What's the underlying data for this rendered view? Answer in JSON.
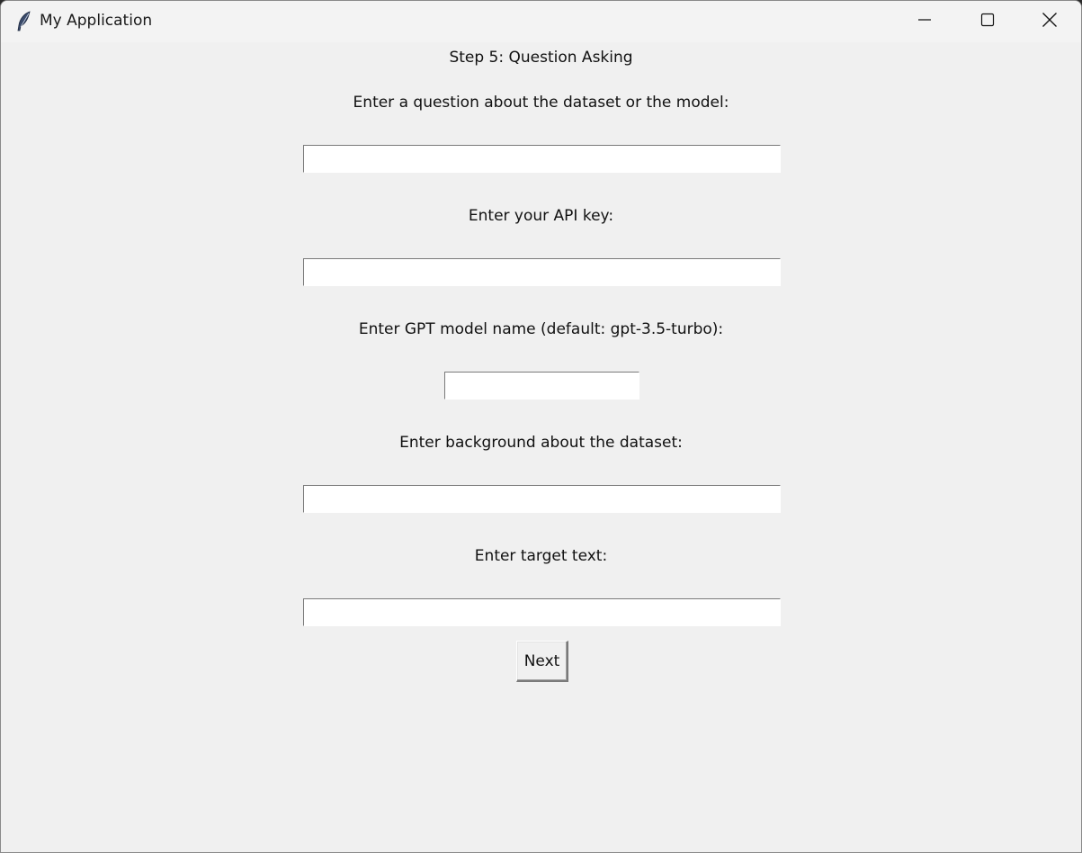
{
  "window": {
    "title": "My Application",
    "icon": "feather-icon",
    "controls": [
      "minimize-icon",
      "maximize-icon",
      "close-icon"
    ]
  },
  "form": {
    "step_title": "Step 5: Question Asking",
    "question_label": "Enter a question about the dataset or the model:",
    "question_value": "",
    "api_key_label": "Enter your API key:",
    "api_key_value": "",
    "model_label": "Enter GPT model name (default: gpt-3.5-turbo):",
    "model_value": "",
    "background_label": "Enter background about the dataset:",
    "background_value": "",
    "target_label": "Enter target text:",
    "target_value": "",
    "next_label": "Next"
  }
}
